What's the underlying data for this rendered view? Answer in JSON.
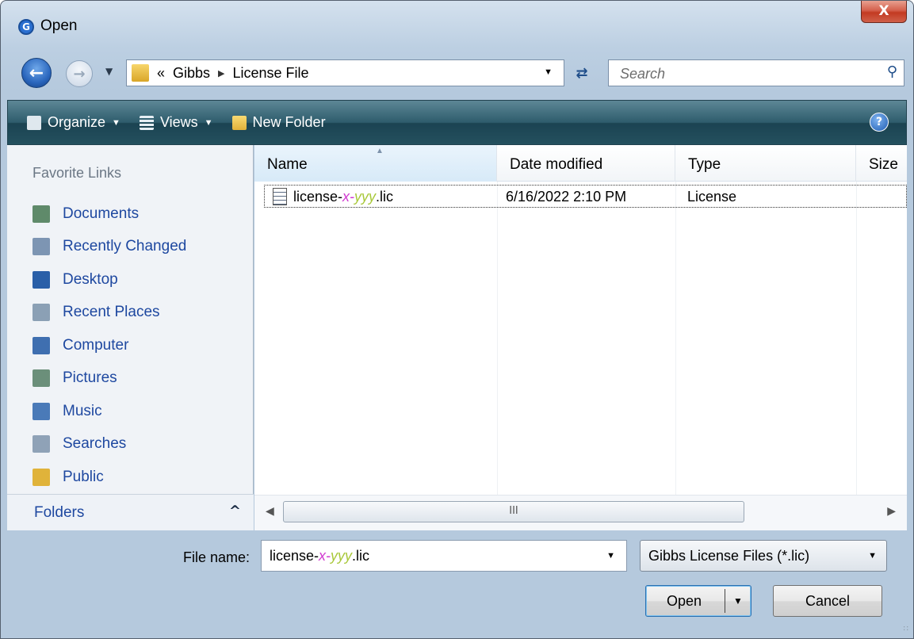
{
  "window": {
    "title": "Open",
    "close_label": "X"
  },
  "address": {
    "overflow": "«",
    "crumbs": [
      "Gibbs",
      "License File"
    ]
  },
  "search": {
    "placeholder": "Search"
  },
  "toolbar": {
    "organize_label": "Organize",
    "views_label": "Views",
    "new_folder_label": "New Folder"
  },
  "favorites": {
    "heading": "Favorite Links",
    "items": [
      {
        "label": "Documents",
        "icon": "documents-icon",
        "color": "#5f8a6a"
      },
      {
        "label": "Recently Changed",
        "icon": "recently-changed-icon",
        "color": "#7d95b3"
      },
      {
        "label": "Desktop",
        "icon": "desktop-icon",
        "color": "#2a5fa8"
      },
      {
        "label": "Recent Places",
        "icon": "recent-places-icon",
        "color": "#8ba0b5"
      },
      {
        "label": "Computer",
        "icon": "computer-icon",
        "color": "#3f6fb0"
      },
      {
        "label": "Pictures",
        "icon": "pictures-icon",
        "color": "#6b8f7a"
      },
      {
        "label": "Music",
        "icon": "music-icon",
        "color": "#4a7ab8"
      },
      {
        "label": "Searches",
        "icon": "searches-icon",
        "color": "#8fa2b7"
      },
      {
        "label": "Public",
        "icon": "public-folder-icon",
        "color": "#e0b33a"
      }
    ],
    "folders_label": "Folders"
  },
  "columns": {
    "name": "Name",
    "date": "Date modified",
    "type": "Type",
    "size": "Size"
  },
  "files": [
    {
      "prefix": "license-",
      "x": "x",
      "dash": "-",
      "y": "yyy",
      "ext": ".lic",
      "date": "6/16/2022 2:10 PM",
      "type": "License"
    }
  ],
  "scroll": {
    "thumb_grip": "III"
  },
  "bottom": {
    "file_name_label": "File name:",
    "file_name": {
      "prefix": "license-",
      "x": "x",
      "dash": "-",
      "y": "yyy",
      "ext": ".lic"
    },
    "filter_label": "Gibbs License Files (*.lic)",
    "open_label": "Open",
    "cancel_label": "Cancel"
  },
  "colors": {
    "x_highlight": "#d13bd1",
    "y_highlight": "#a8c83a",
    "toolbar": "#2e5c6c",
    "link": "#1e48a0"
  }
}
